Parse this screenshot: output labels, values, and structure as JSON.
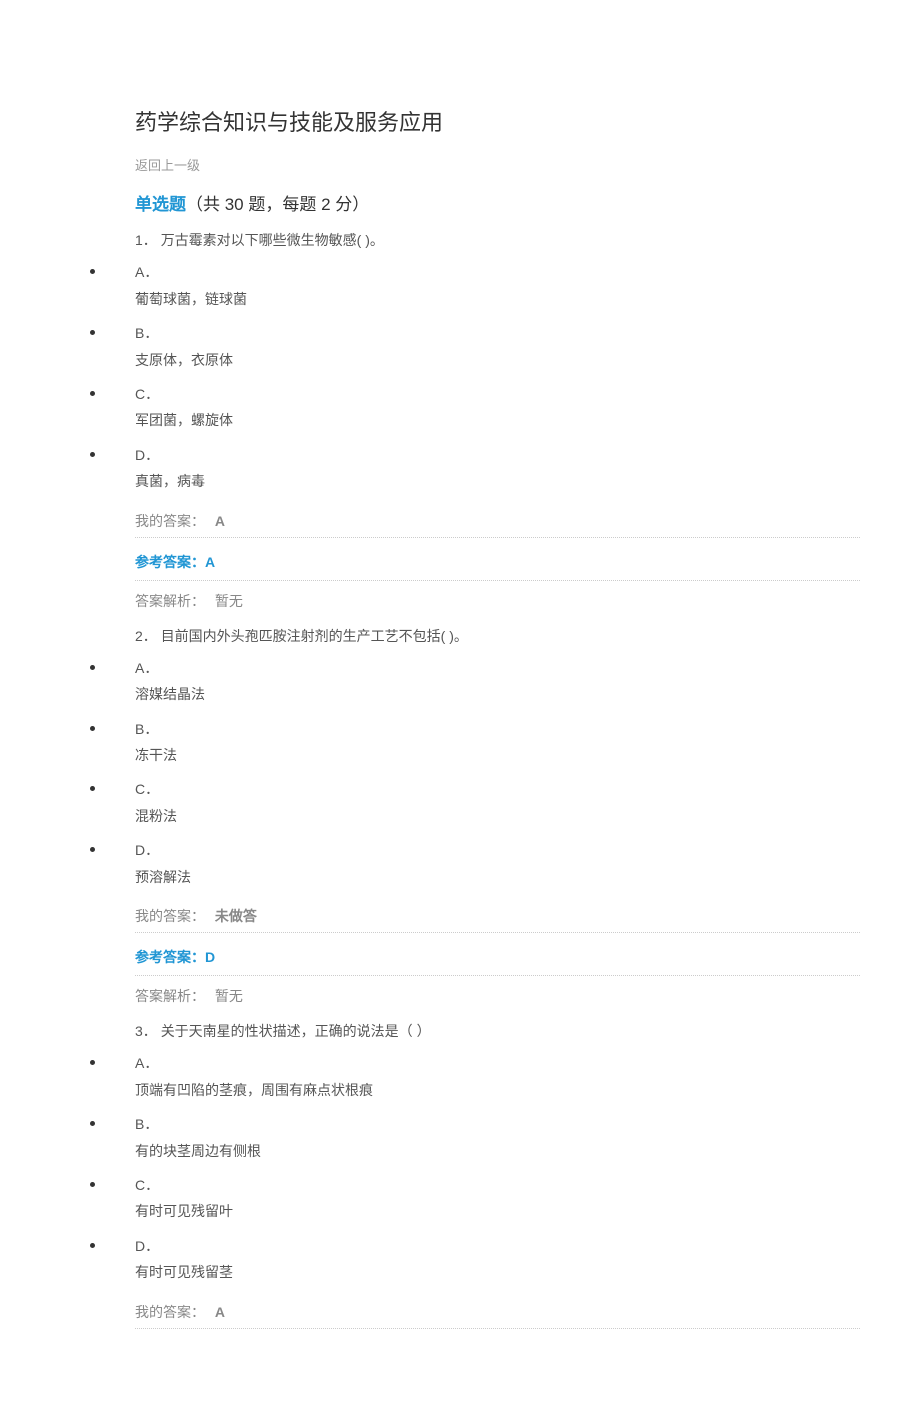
{
  "page_title": "药学综合知识与技能及服务应用",
  "back_link": "返回上一级",
  "section": {
    "highlight": "单选题",
    "rest": "（共 30 题，每题 2 分）"
  },
  "labels": {
    "my_answer": "我的答案：",
    "ref_answer": "参考答案：",
    "analysis": "答案解析：",
    "not_answered": "未做答",
    "no_analysis": "暂无"
  },
  "questions": [
    {
      "number": "1．",
      "text": "万古霉素对以下哪些微生物敏感( )。",
      "options": [
        {
          "label": "A．",
          "text": "葡萄球菌，链球菌"
        },
        {
          "label": "B．",
          "text": "支原体，衣原体"
        },
        {
          "label": "C．",
          "text": "军团菌，螺旋体"
        },
        {
          "label": "D．",
          "text": "真菌，病毒"
        }
      ],
      "my_answer": "A",
      "ref_answer": "A",
      "analysis": "暂无"
    },
    {
      "number": "2．",
      "text": "目前国内外头孢匹胺注射剂的生产工艺不包括( )。",
      "options": [
        {
          "label": "A．",
          "text": "溶媒结晶法"
        },
        {
          "label": "B．",
          "text": "冻干法"
        },
        {
          "label": "C．",
          "text": "混粉法"
        },
        {
          "label": "D．",
          "text": "预溶解法"
        }
      ],
      "my_answer": "未做答",
      "ref_answer": "D",
      "analysis": "暂无"
    },
    {
      "number": "3．",
      "text": "关于天南星的性状描述，正确的说法是（ ）",
      "options": [
        {
          "label": "A．",
          "text": "顶端有凹陷的茎痕，周围有麻点状根痕"
        },
        {
          "label": "B．",
          "text": "有的块茎周边有侧根"
        },
        {
          "label": "C．",
          "text": "有时可见残留叶"
        },
        {
          "label": "D．",
          "text": "有时可见残留茎"
        }
      ],
      "my_answer": "A",
      "ref_answer": null,
      "analysis": null
    }
  ]
}
